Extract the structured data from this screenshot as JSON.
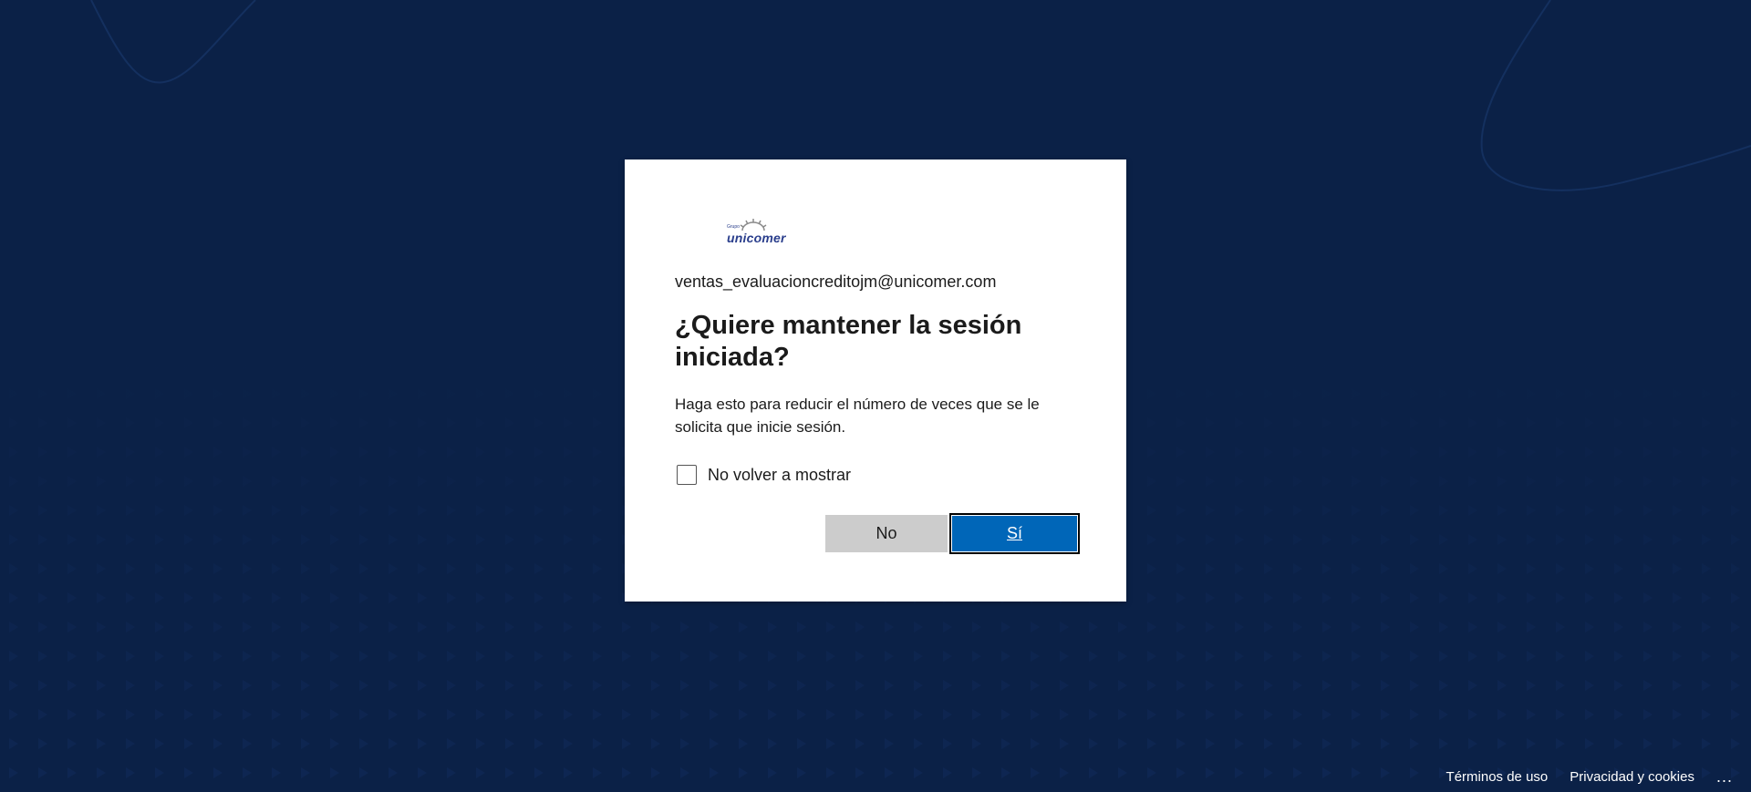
{
  "brand": {
    "logo_text": "unicomer",
    "logo_small_text": "Grupo",
    "logo_color": "#2a3e8c"
  },
  "dialog": {
    "identity": "ventas_evaluacioncreditojm@unicomer.com",
    "title": "¿Quiere mantener la sesión iniciada?",
    "description": "Haga esto para reducir el número de veces que se le solicita que inicie sesión.",
    "checkbox_label": "No volver a mostrar",
    "checkbox_checked": false,
    "no_button": "No",
    "yes_button": "Sí"
  },
  "footer": {
    "terms": "Términos de uso",
    "privacy": "Privacidad y cookies",
    "more": "..."
  },
  "colors": {
    "background": "#0b2147",
    "primary_button": "#0066b8",
    "secondary_button": "#cccccc"
  }
}
